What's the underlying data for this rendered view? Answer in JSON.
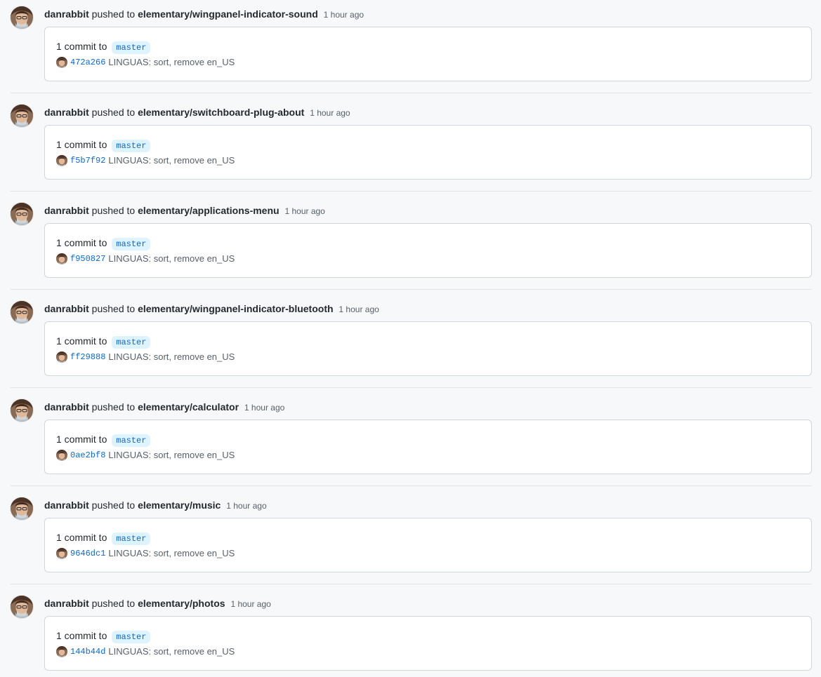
{
  "feed": [
    {
      "user": "danrabbit",
      "action": "pushed to",
      "repo": "elementary/wingpanel-indicator-sound",
      "time": "1 hour ago",
      "summary": "1 commit to",
      "branch": "master",
      "sha": "472a266",
      "message": "LINGUAS: sort, remove en_US"
    },
    {
      "user": "danrabbit",
      "action": "pushed to",
      "repo": "elementary/switchboard-plug-about",
      "time": "1 hour ago",
      "summary": "1 commit to",
      "branch": "master",
      "sha": "f5b7f92",
      "message": "LINGUAS: sort, remove en_US"
    },
    {
      "user": "danrabbit",
      "action": "pushed to",
      "repo": "elementary/applications-menu",
      "time": "1 hour ago",
      "summary": "1 commit to",
      "branch": "master",
      "sha": "f950827",
      "message": "LINGUAS: sort, remove en_US"
    },
    {
      "user": "danrabbit",
      "action": "pushed to",
      "repo": "elementary/wingpanel-indicator-bluetooth",
      "time": "1 hour ago",
      "summary": "1 commit to",
      "branch": "master",
      "sha": "ff29888",
      "message": "LINGUAS: sort, remove en_US"
    },
    {
      "user": "danrabbit",
      "action": "pushed to",
      "repo": "elementary/calculator",
      "time": "1 hour ago",
      "summary": "1 commit to",
      "branch": "master",
      "sha": "0ae2bf8",
      "message": "LINGUAS: sort, remove en_US"
    },
    {
      "user": "danrabbit",
      "action": "pushed to",
      "repo": "elementary/music",
      "time": "1 hour ago",
      "summary": "1 commit to",
      "branch": "master",
      "sha": "9646dc1",
      "message": "LINGUAS: sort, remove en_US"
    },
    {
      "user": "danrabbit",
      "action": "pushed to",
      "repo": "elementary/photos",
      "time": "1 hour ago",
      "summary": "1 commit to",
      "branch": "master",
      "sha": "144b44d",
      "message": "LINGUAS: sort, remove en_US"
    }
  ],
  "colors": {
    "background": "#f6f8fa",
    "link": "#0969da",
    "branch_bg": "#ddf4ff",
    "muted": "#57606a",
    "border": "#d0d7de"
  },
  "icons": {
    "avatar": "user-avatar-photo"
  }
}
